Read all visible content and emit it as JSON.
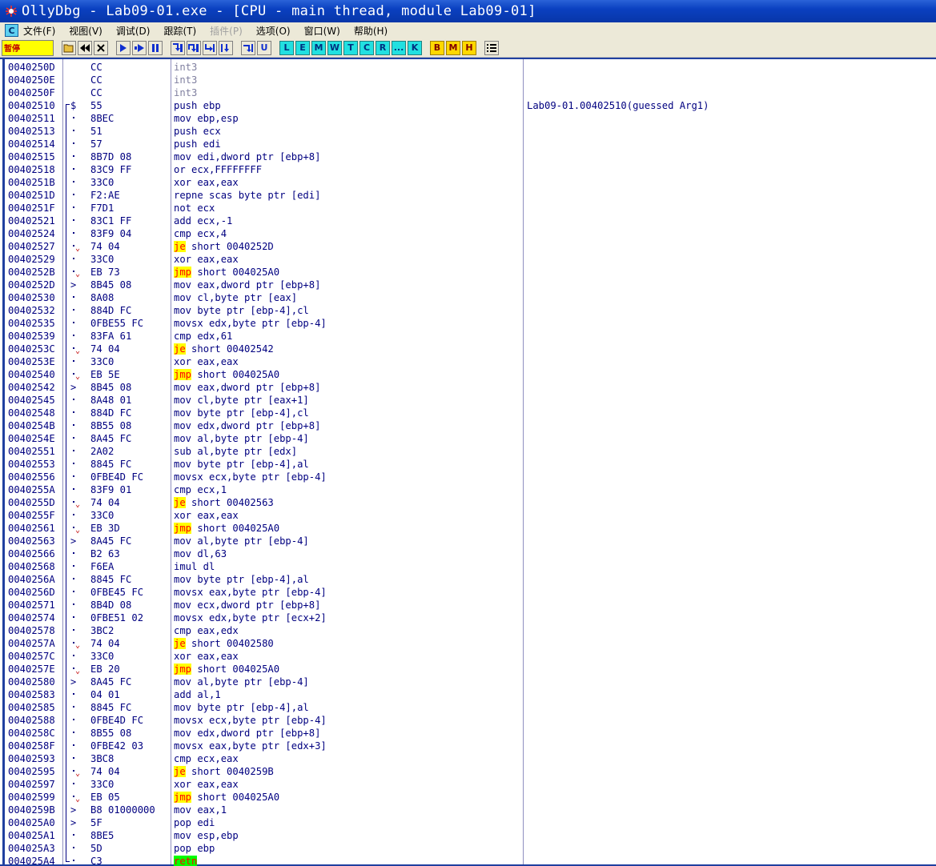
{
  "window": {
    "title": "OllyDbg - Lab09-01.exe - [CPU - main thread, module Lab09-01]"
  },
  "menu": {
    "logo": "C",
    "items": [
      "文件(F)",
      "视图(V)",
      "调试(D)",
      "跟踪(T)",
      "插件(P)",
      "选项(O)",
      "窗口(W)",
      "帮助(H)"
    ],
    "disabled_index": 4
  },
  "toolbar": {
    "status": "暂停",
    "letters_cyan": [
      "L",
      "E",
      "M",
      "W",
      "T",
      "C",
      "R",
      "...",
      "K"
    ],
    "letters_yellow": [
      "B",
      "M",
      "H"
    ]
  },
  "disasm": {
    "rows": [
      {
        "addr": "0040250D",
        "hex": "CC",
        "asm": "int3",
        "mark": "",
        "kind": "int"
      },
      {
        "addr": "0040250E",
        "hex": "CC",
        "asm": "int3",
        "mark": "",
        "kind": "int"
      },
      {
        "addr": "0040250F",
        "hex": "CC",
        "asm": "int3",
        "mark": "",
        "kind": "int"
      },
      {
        "addr": "00402510",
        "hex": "55",
        "asm": "push ebp",
        "mark": "$",
        "kind": "",
        "comment": "Lab09-01.00402510(guessed Arg1)"
      },
      {
        "addr": "00402511",
        "hex": "8BEC",
        "asm": "mov ebp,esp",
        "mark": ".",
        "kind": ""
      },
      {
        "addr": "00402513",
        "hex": "51",
        "asm": "push ecx",
        "mark": ".",
        "kind": ""
      },
      {
        "addr": "00402514",
        "hex": "57",
        "asm": "push edi",
        "mark": ".",
        "kind": ""
      },
      {
        "addr": "00402515",
        "hex": "8B7D 08",
        "asm": "mov edi,dword ptr [ebp+8]",
        "mark": ".",
        "kind": ""
      },
      {
        "addr": "00402518",
        "hex": "83C9 FF",
        "asm": "or ecx,FFFFFFFF",
        "mark": ".",
        "kind": ""
      },
      {
        "addr": "0040251B",
        "hex": "33C0",
        "asm": "xor eax,eax",
        "mark": ".",
        "kind": ""
      },
      {
        "addr": "0040251D",
        "hex": "F2:AE",
        "asm": "repne scas byte ptr [edi]",
        "mark": ".",
        "kind": ""
      },
      {
        "addr": "0040251F",
        "hex": "F7D1",
        "asm": "not ecx",
        "mark": ".",
        "kind": ""
      },
      {
        "addr": "00402521",
        "hex": "83C1 FF",
        "asm": "add ecx,-1",
        "mark": ".",
        "kind": ""
      },
      {
        "addr": "00402524",
        "hex": "83F9 04",
        "asm": "cmp ecx,4",
        "mark": ".",
        "kind": ""
      },
      {
        "addr": "00402527",
        "hex": "74 04",
        "asm_op": "je",
        "asm_rest": " short 0040252D",
        "mark": ".v",
        "kind": "jmp"
      },
      {
        "addr": "00402529",
        "hex": "33C0",
        "asm": "xor eax,eax",
        "mark": ".",
        "kind": ""
      },
      {
        "addr": "0040252B",
        "hex": "EB 73",
        "asm_op": "jmp",
        "asm_rest": " short 004025A0",
        "mark": ".v",
        "kind": "jmp"
      },
      {
        "addr": "0040252D",
        "hex": "8B45 08",
        "asm": "mov eax,dword ptr [ebp+8]",
        "mark": ">",
        "kind": ""
      },
      {
        "addr": "00402530",
        "hex": "8A08",
        "asm": "mov cl,byte ptr [eax]",
        "mark": ".",
        "kind": ""
      },
      {
        "addr": "00402532",
        "hex": "884D FC",
        "asm": "mov byte ptr [ebp-4],cl",
        "mark": ".",
        "kind": ""
      },
      {
        "addr": "00402535",
        "hex": "0FBE55 FC",
        "asm": "movsx edx,byte ptr [ebp-4]",
        "mark": ".",
        "kind": ""
      },
      {
        "addr": "00402539",
        "hex": "83FA 61",
        "asm": "cmp edx,61",
        "mark": ".",
        "kind": ""
      },
      {
        "addr": "0040253C",
        "hex": "74 04",
        "asm_op": "je",
        "asm_rest": " short 00402542",
        "mark": ".v",
        "kind": "jmp"
      },
      {
        "addr": "0040253E",
        "hex": "33C0",
        "asm": "xor eax,eax",
        "mark": ".",
        "kind": ""
      },
      {
        "addr": "00402540",
        "hex": "EB 5E",
        "asm_op": "jmp",
        "asm_rest": " short 004025A0",
        "mark": ".v",
        "kind": "jmp"
      },
      {
        "addr": "00402542",
        "hex": "8B45 08",
        "asm": "mov eax,dword ptr [ebp+8]",
        "mark": ">",
        "kind": ""
      },
      {
        "addr": "00402545",
        "hex": "8A48 01",
        "asm": "mov cl,byte ptr [eax+1]",
        "mark": ".",
        "kind": ""
      },
      {
        "addr": "00402548",
        "hex": "884D FC",
        "asm": "mov byte ptr [ebp-4],cl",
        "mark": ".",
        "kind": ""
      },
      {
        "addr": "0040254B",
        "hex": "8B55 08",
        "asm": "mov edx,dword ptr [ebp+8]",
        "mark": ".",
        "kind": ""
      },
      {
        "addr": "0040254E",
        "hex": "8A45 FC",
        "asm": "mov al,byte ptr [ebp-4]",
        "mark": ".",
        "kind": ""
      },
      {
        "addr": "00402551",
        "hex": "2A02",
        "asm": "sub al,byte ptr [edx]",
        "mark": ".",
        "kind": ""
      },
      {
        "addr": "00402553",
        "hex": "8845 FC",
        "asm": "mov byte ptr [ebp-4],al",
        "mark": ".",
        "kind": ""
      },
      {
        "addr": "00402556",
        "hex": "0FBE4D FC",
        "asm": "movsx ecx,byte ptr [ebp-4]",
        "mark": ".",
        "kind": ""
      },
      {
        "addr": "0040255A",
        "hex": "83F9 01",
        "asm": "cmp ecx,1",
        "mark": ".",
        "kind": ""
      },
      {
        "addr": "0040255D",
        "hex": "74 04",
        "asm_op": "je",
        "asm_rest": " short 00402563",
        "mark": ".v",
        "kind": "jmp"
      },
      {
        "addr": "0040255F",
        "hex": "33C0",
        "asm": "xor eax,eax",
        "mark": ".",
        "kind": ""
      },
      {
        "addr": "00402561",
        "hex": "EB 3D",
        "asm_op": "jmp",
        "asm_rest": " short 004025A0",
        "mark": ".v",
        "kind": "jmp"
      },
      {
        "addr": "00402563",
        "hex": "8A45 FC",
        "asm": "mov al,byte ptr [ebp-4]",
        "mark": ">",
        "kind": ""
      },
      {
        "addr": "00402566",
        "hex": "B2 63",
        "asm": "mov dl,63",
        "mark": ".",
        "kind": ""
      },
      {
        "addr": "00402568",
        "hex": "F6EA",
        "asm": "imul dl",
        "mark": ".",
        "kind": ""
      },
      {
        "addr": "0040256A",
        "hex": "8845 FC",
        "asm": "mov byte ptr [ebp-4],al",
        "mark": ".",
        "kind": ""
      },
      {
        "addr": "0040256D",
        "hex": "0FBE45 FC",
        "asm": "movsx eax,byte ptr [ebp-4]",
        "mark": ".",
        "kind": ""
      },
      {
        "addr": "00402571",
        "hex": "8B4D 08",
        "asm": "mov ecx,dword ptr [ebp+8]",
        "mark": ".",
        "kind": ""
      },
      {
        "addr": "00402574",
        "hex": "0FBE51 02",
        "asm": "movsx edx,byte ptr [ecx+2]",
        "mark": ".",
        "kind": ""
      },
      {
        "addr": "00402578",
        "hex": "3BC2",
        "asm": "cmp eax,edx",
        "mark": ".",
        "kind": ""
      },
      {
        "addr": "0040257A",
        "hex": "74 04",
        "asm_op": "je",
        "asm_rest": " short 00402580",
        "mark": ".v",
        "kind": "jmp"
      },
      {
        "addr": "0040257C",
        "hex": "33C0",
        "asm": "xor eax,eax",
        "mark": ".",
        "kind": ""
      },
      {
        "addr": "0040257E",
        "hex": "EB 20",
        "asm_op": "jmp",
        "asm_rest": " short 004025A0",
        "mark": ".v",
        "kind": "jmp"
      },
      {
        "addr": "00402580",
        "hex": "8A45 FC",
        "asm": "mov al,byte ptr [ebp-4]",
        "mark": ">",
        "kind": ""
      },
      {
        "addr": "00402583",
        "hex": "04 01",
        "asm": "add al,1",
        "mark": ".",
        "kind": ""
      },
      {
        "addr": "00402585",
        "hex": "8845 FC",
        "asm": "mov byte ptr [ebp-4],al",
        "mark": ".",
        "kind": ""
      },
      {
        "addr": "00402588",
        "hex": "0FBE4D FC",
        "asm": "movsx ecx,byte ptr [ebp-4]",
        "mark": ".",
        "kind": ""
      },
      {
        "addr": "0040258C",
        "hex": "8B55 08",
        "asm": "mov edx,dword ptr [ebp+8]",
        "mark": ".",
        "kind": ""
      },
      {
        "addr": "0040258F",
        "hex": "0FBE42 03",
        "asm": "movsx eax,byte ptr [edx+3]",
        "mark": ".",
        "kind": ""
      },
      {
        "addr": "00402593",
        "hex": "3BC8",
        "asm": "cmp ecx,eax",
        "mark": ".",
        "kind": ""
      },
      {
        "addr": "00402595",
        "hex": "74 04",
        "asm_op": "je",
        "asm_rest": " short 0040259B",
        "mark": ".v",
        "kind": "jmp"
      },
      {
        "addr": "00402597",
        "hex": "33C0",
        "asm": "xor eax,eax",
        "mark": ".",
        "kind": ""
      },
      {
        "addr": "00402599",
        "hex": "EB 05",
        "asm_op": "jmp",
        "asm_rest": " short 004025A0",
        "mark": ".v",
        "kind": "jmp"
      },
      {
        "addr": "0040259B",
        "hex": "B8 01000000",
        "asm": "mov eax,1",
        "mark": ">",
        "kind": ""
      },
      {
        "addr": "004025A0",
        "hex": "5F",
        "asm": "pop edi",
        "mark": ">",
        "kind": ""
      },
      {
        "addr": "004025A1",
        "hex": "8BE5",
        "asm": "mov esp,ebp",
        "mark": ".",
        "kind": ""
      },
      {
        "addr": "004025A3",
        "hex": "5D",
        "asm": "pop ebp",
        "mark": ".",
        "kind": ""
      },
      {
        "addr": "004025A4",
        "hex": "C3",
        "asm_op": "retn",
        "asm_rest": "",
        "mark": "L.",
        "kind": "ret"
      }
    ]
  }
}
